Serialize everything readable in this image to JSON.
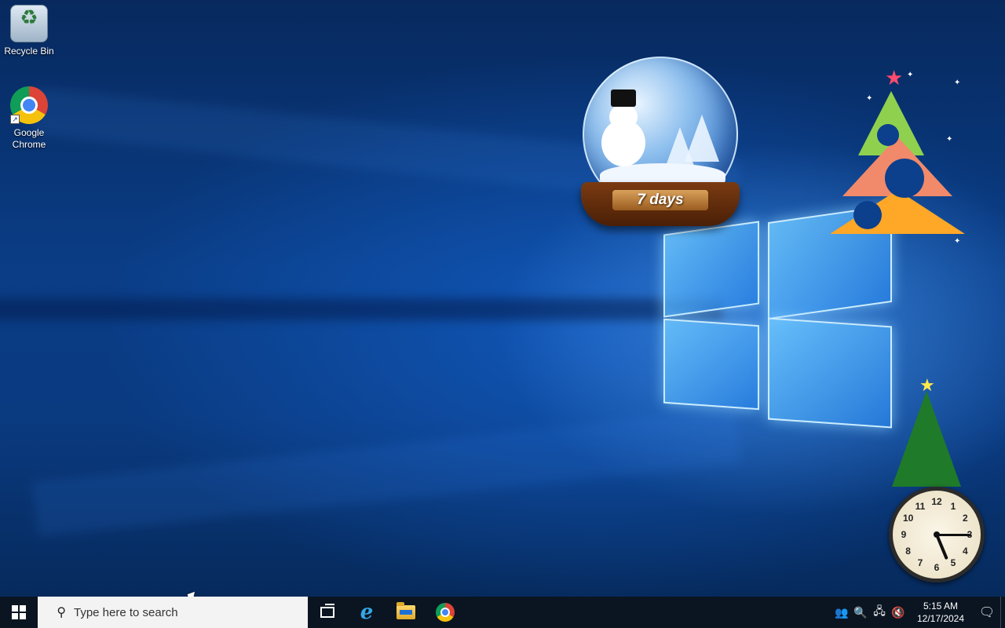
{
  "desktop": {
    "icons": [
      {
        "label": "Recycle Bin",
        "icon": "recycle-bin-icon"
      },
      {
        "label": "Google Chrome",
        "icon": "chrome-icon"
      }
    ]
  },
  "gadgets": {
    "snow_globe": {
      "label": "7 days"
    },
    "clock": {
      "numbers": [
        "12",
        "1",
        "2",
        "3",
        "4",
        "5",
        "6",
        "7",
        "8",
        "9",
        "10",
        "11"
      ],
      "time_hours": 5,
      "time_minutes": 15
    }
  },
  "taskbar": {
    "search": {
      "placeholder": "Type here to search"
    },
    "pinned": [
      {
        "name": "task-view",
        "icon": "task-view-icon"
      },
      {
        "name": "internet-explorer",
        "icon": "ie-icon"
      },
      {
        "name": "file-explorer",
        "icon": "folder-icon"
      },
      {
        "name": "google-chrome",
        "icon": "chrome-icon"
      }
    ],
    "tray": {
      "time": "5:15 AM",
      "date": "12/17/2024"
    }
  },
  "colors": {
    "taskbar_bg": "#0b1521",
    "desktop_bg": "#0a3d86",
    "search_bg": "#f3f3f3"
  }
}
